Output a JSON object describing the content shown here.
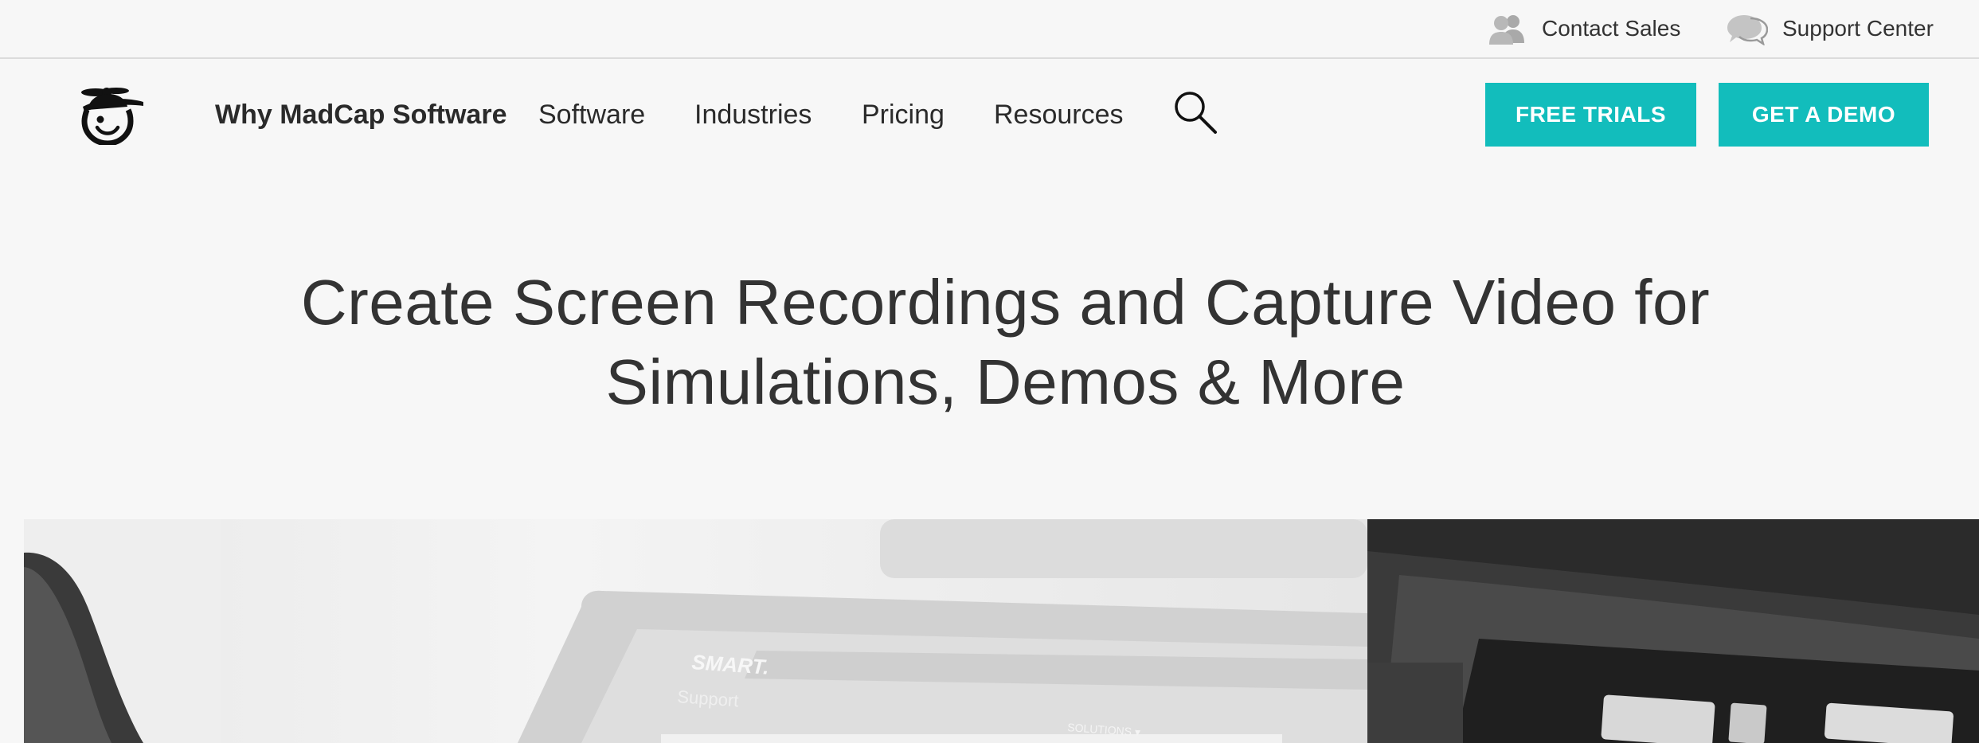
{
  "utility": {
    "contact_sales": "Contact Sales",
    "support_center": "Support Center"
  },
  "nav": {
    "logo_icon": "madcap-logo-icon",
    "items": [
      {
        "label": "Why MadCap Software"
      },
      {
        "label": "Software"
      },
      {
        "label": "Industries"
      },
      {
        "label": "Pricing"
      },
      {
        "label": "Resources"
      }
    ],
    "search_icon": "search-icon",
    "free_trials": "FREE TRIALS",
    "get_demo": "GET A DEMO"
  },
  "hero": {
    "title_line1": "Create Screen Recordings and Capture Video for",
    "title_line2": "Simulations, Demos & More",
    "image_text": {
      "brand": "SMART.",
      "sub": "Support",
      "menu": "SOLUTIONS ▾"
    }
  },
  "colors": {
    "accent": "#12bdbc",
    "text": "#333333",
    "background": "#f7f7f7"
  }
}
